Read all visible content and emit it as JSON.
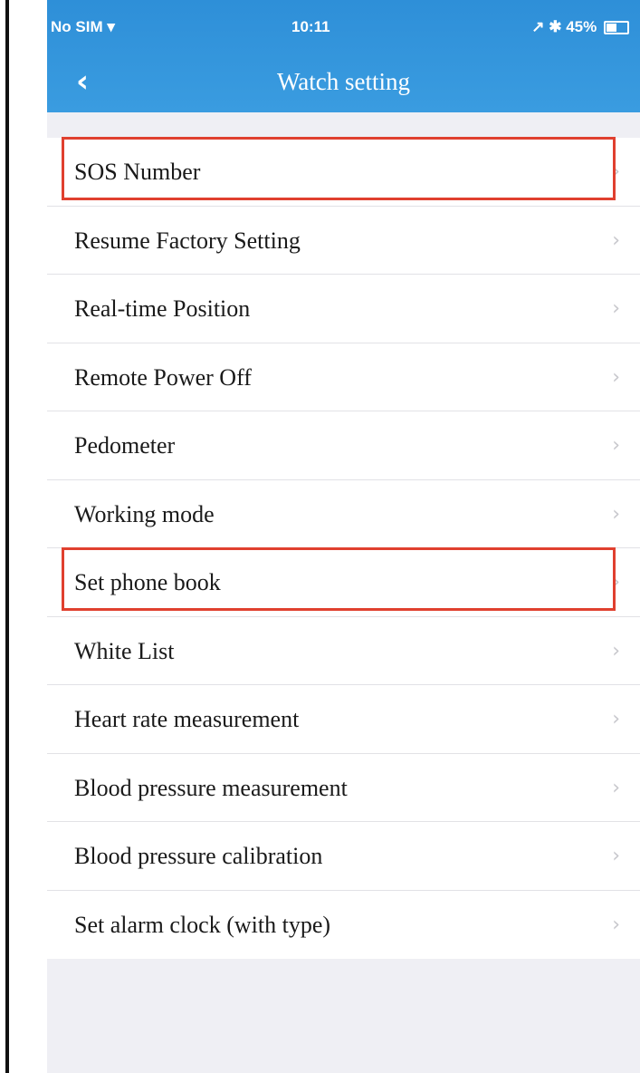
{
  "status_bar": {
    "carrier": "No SIM ▾",
    "time": "10:11",
    "battery": "↗ ✱ 45%",
    "battery_level": 0.45
  },
  "header": {
    "back_icon": "‹",
    "title": "Watch setting"
  },
  "chevron_glyph": "›",
  "highlight_color": "#e0402f",
  "accent_color": "#2e8fd8",
  "settings": {
    "items": [
      {
        "label": "SOS Number",
        "highlighted": true
      },
      {
        "label": "Resume Factory Setting",
        "highlighted": false
      },
      {
        "label": "Real-time Position",
        "highlighted": false
      },
      {
        "label": "Remote Power Off",
        "highlighted": false
      },
      {
        "label": "Pedometer",
        "highlighted": false
      },
      {
        "label": "Working mode",
        "highlighted": false
      },
      {
        "label": "Set phone book",
        "highlighted": true
      },
      {
        "label": "White List",
        "highlighted": false
      },
      {
        "label": "Heart rate measurement",
        "highlighted": false
      },
      {
        "label": "Blood pressure measurement",
        "highlighted": false
      },
      {
        "label": "Blood pressure calibration",
        "highlighted": false
      },
      {
        "label": "Set alarm clock (with type)",
        "highlighted": false
      }
    ]
  }
}
